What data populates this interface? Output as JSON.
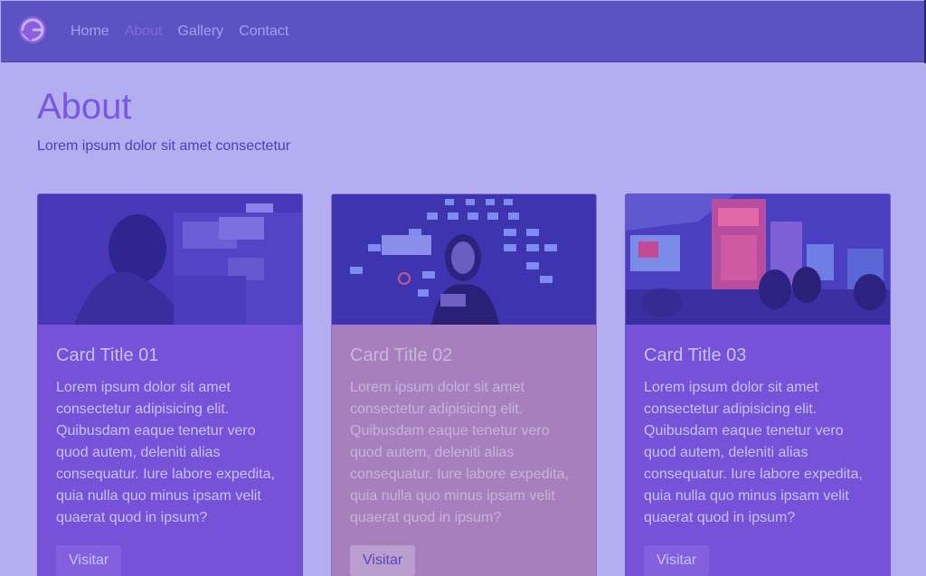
{
  "nav": {
    "logo_icon": "gatsby-logo-icon",
    "links": [
      "Home",
      "About",
      "Gallery",
      "Contact"
    ],
    "active": "About"
  },
  "page": {
    "title": "About",
    "subtitle": "Lorem ipsum dolor sit amet consectetur"
  },
  "cards": [
    {
      "title": "Card Title 01",
      "text": "Lorem ipsum dolor sit amet consectetur adipisicing elit. Quibusdam eaque tenetur vero quod autem, deleniti alias consequatur. Iure labore expedita, quia nulla quo minus ipsam velit quaerat quod in ipsum?",
      "button": "Visitar",
      "image": "gamer-with-headset-photo"
    },
    {
      "title": "Card Title 02",
      "text": "Lorem ipsum dolor sit amet consectetur adipisicing elit. Quibusdam eaque tenetur vero quod autem, deleniti alias consequatur. Iure labore expedita, quia nulla quo minus ipsam velit quaerat quod in ipsum?",
      "button": "Visitar",
      "image": "space-invaders-woman-photo"
    },
    {
      "title": "Card Title 03",
      "text": "Lorem ipsum dolor sit amet consectetur adipisicing elit. Quibusdam eaque tenetur vero quod autem, deleniti alias consequatur. Iure labore expedita, quia nulla quo minus ipsam velit quaerat quod in ipsum?",
      "button": "Visitar",
      "image": "neon-city-street-photo"
    }
  ],
  "colors": {
    "navbar": "#5b52c4",
    "background": "#b3aef0",
    "card": "#7652d8",
    "card_highlight": "#a77fbe"
  }
}
